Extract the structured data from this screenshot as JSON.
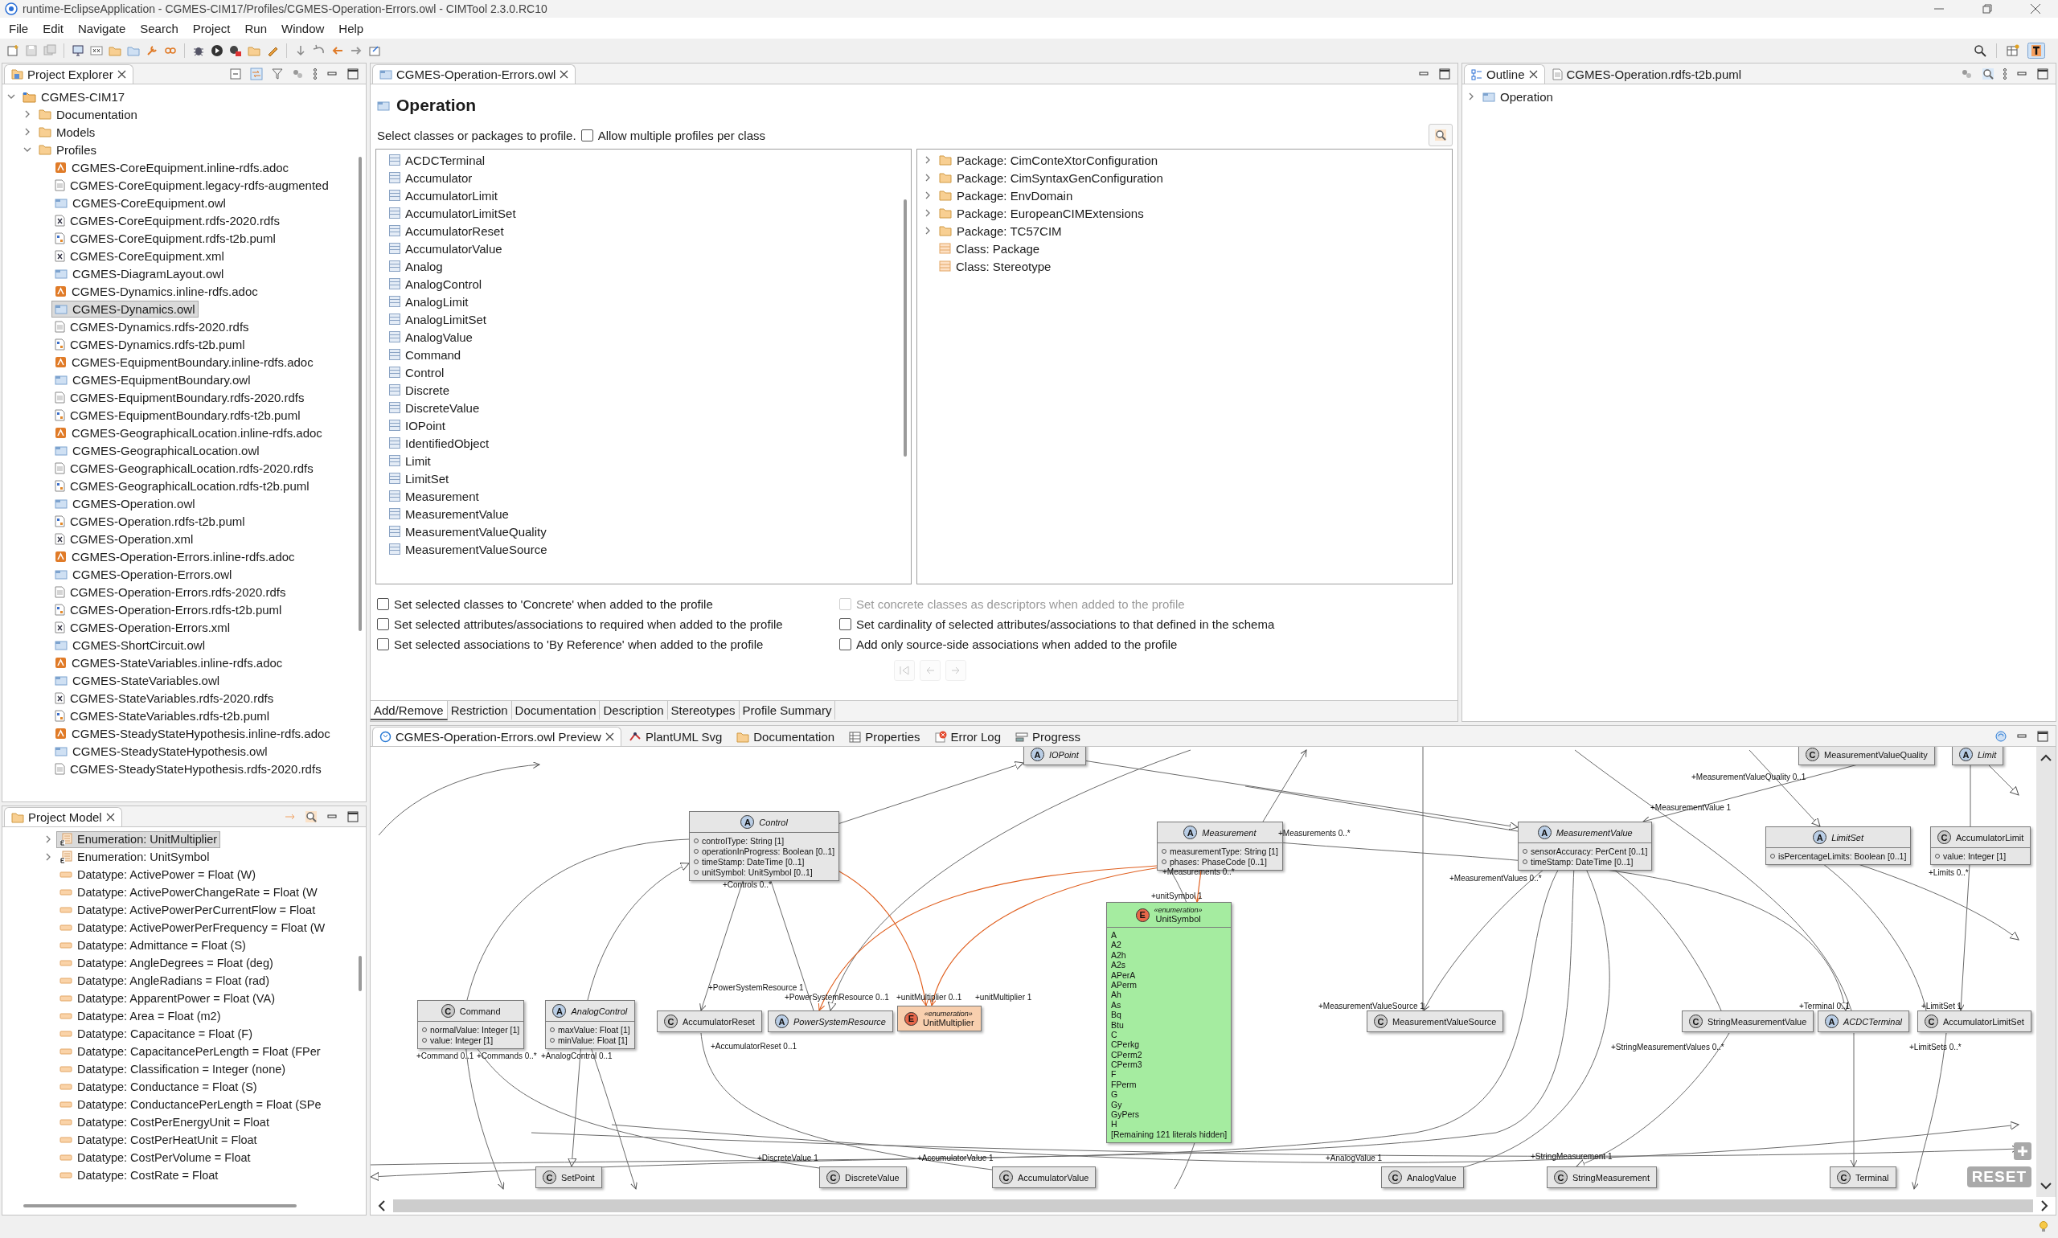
{
  "window": {
    "title": "runtime-EclipseApplication - CGMES-CIM17/Profiles/CGMES-Operation-Errors.owl - CIMTool 2.3.0.RC10"
  },
  "menu": [
    "File",
    "Edit",
    "Navigate",
    "Search",
    "Project",
    "Run",
    "Window",
    "Help"
  ],
  "project_explorer": {
    "title": "Project Explorer",
    "tree": [
      {
        "label": "CGMES-CIM17",
        "kind": "project",
        "expanded": true,
        "selected": false,
        "children": [
          {
            "label": "Documentation",
            "kind": "folder",
            "expanded": false,
            "selected": false
          },
          {
            "label": "Models",
            "kind": "folder",
            "expanded": false,
            "selected": false
          },
          {
            "label": "Profiles",
            "kind": "folder",
            "expanded": true,
            "selected": false,
            "children": [
              {
                "label": "CGMES-CoreEquipment.inline-rdfs.adoc",
                "kind": "adoc",
                "selected": false
              },
              {
                "label": "CGMES-CoreEquipment.legacy-rdfs-augmented",
                "kind": "text",
                "selected": false
              },
              {
                "label": "CGMES-CoreEquipment.owl",
                "kind": "owl",
                "selected": false
              },
              {
                "label": "CGMES-CoreEquipment.rdfs-2020.rdfs",
                "kind": "xml",
                "selected": false
              },
              {
                "label": "CGMES-CoreEquipment.rdfs-t2b.puml",
                "kind": "puml",
                "selected": false
              },
              {
                "label": "CGMES-CoreEquipment.xml",
                "kind": "xml",
                "selected": false
              },
              {
                "label": "CGMES-DiagramLayout.owl",
                "kind": "owl",
                "selected": false
              },
              {
                "label": "CGMES-Dynamics.inline-rdfs.adoc",
                "kind": "adoc",
                "selected": false
              },
              {
                "label": "CGMES-Dynamics.owl",
                "kind": "owl",
                "selected": true
              },
              {
                "label": "CGMES-Dynamics.rdfs-2020.rdfs",
                "kind": "text",
                "selected": false
              },
              {
                "label": "CGMES-Dynamics.rdfs-t2b.puml",
                "kind": "puml",
                "selected": false
              },
              {
                "label": "CGMES-EquipmentBoundary.inline-rdfs.adoc",
                "kind": "adoc",
                "selected": false
              },
              {
                "label": "CGMES-EquipmentBoundary.owl",
                "kind": "owl",
                "selected": false
              },
              {
                "label": "CGMES-EquipmentBoundary.rdfs-2020.rdfs",
                "kind": "text",
                "selected": false
              },
              {
                "label": "CGMES-EquipmentBoundary.rdfs-t2b.puml",
                "kind": "puml",
                "selected": false
              },
              {
                "label": "CGMES-GeographicalLocation.inline-rdfs.adoc",
                "kind": "adoc",
                "selected": false
              },
              {
                "label": "CGMES-GeographicalLocation.owl",
                "kind": "owl",
                "selected": false
              },
              {
                "label": "CGMES-GeographicalLocation.rdfs-2020.rdfs",
                "kind": "text",
                "selected": false
              },
              {
                "label": "CGMES-GeographicalLocation.rdfs-t2b.puml",
                "kind": "puml",
                "selected": false
              },
              {
                "label": "CGMES-Operation.owl",
                "kind": "owl",
                "selected": false
              },
              {
                "label": "CGMES-Operation.rdfs-t2b.puml",
                "kind": "puml",
                "selected": false
              },
              {
                "label": "CGMES-Operation.xml",
                "kind": "xml",
                "selected": false
              },
              {
                "label": "CGMES-Operation-Errors.inline-rdfs.adoc",
                "kind": "adoc",
                "selected": false
              },
              {
                "label": "CGMES-Operation-Errors.owl",
                "kind": "owl",
                "selected": false
              },
              {
                "label": "CGMES-Operation-Errors.rdfs-2020.rdfs",
                "kind": "text",
                "selected": false
              },
              {
                "label": "CGMES-Operation-Errors.rdfs-t2b.puml",
                "kind": "puml",
                "selected": false
              },
              {
                "label": "CGMES-Operation-Errors.xml",
                "kind": "xml",
                "selected": false
              },
              {
                "label": "CGMES-ShortCircuit.owl",
                "kind": "owl",
                "selected": false
              },
              {
                "label": "CGMES-StateVariables.inline-rdfs.adoc",
                "kind": "adoc",
                "selected": false
              },
              {
                "label": "CGMES-StateVariables.owl",
                "kind": "owl",
                "selected": false
              },
              {
                "label": "CGMES-StateVariables.rdfs-2020.rdfs",
                "kind": "xml",
                "selected": false
              },
              {
                "label": "CGMES-StateVariables.rdfs-t2b.puml",
                "kind": "puml",
                "selected": false
              },
              {
                "label": "CGMES-SteadyStateHypothesis.inline-rdfs.adoc",
                "kind": "adoc",
                "selected": false
              },
              {
                "label": "CGMES-SteadyStateHypothesis.owl",
                "kind": "owl",
                "selected": false
              },
              {
                "label": "CGMES-SteadyStateHypothesis.rdfs-2020.rdfs",
                "kind": "text",
                "selected": false
              }
            ]
          }
        ]
      }
    ]
  },
  "project_model": {
    "title": "Project Model",
    "items": [
      {
        "label": "Enumeration: UnitMultiplier",
        "kind": "enumeration",
        "expanded": false,
        "selected": true
      },
      {
        "label": "Enumeration: UnitSymbol",
        "kind": "enumeration",
        "expanded": false,
        "selected": false
      },
      {
        "label": "Datatype: ActivePower = Float (W)",
        "kind": "datatype",
        "selected": false
      },
      {
        "label": "Datatype: ActivePowerChangeRate = Float (W",
        "kind": "datatype",
        "selected": false
      },
      {
        "label": "Datatype: ActivePowerPerCurrentFlow = Float",
        "kind": "datatype",
        "selected": false
      },
      {
        "label": "Datatype: ActivePowerPerFrequency = Float (W",
        "kind": "datatype",
        "selected": false
      },
      {
        "label": "Datatype: Admittance = Float (S)",
        "kind": "datatype",
        "selected": false
      },
      {
        "label": "Datatype: AngleDegrees = Float (deg)",
        "kind": "datatype",
        "selected": false
      },
      {
        "label": "Datatype: AngleRadians = Float (rad)",
        "kind": "datatype",
        "selected": false
      },
      {
        "label": "Datatype: ApparentPower = Float (VA)",
        "kind": "datatype",
        "selected": false
      },
      {
        "label": "Datatype: Area = Float (m2)",
        "kind": "datatype",
        "selected": false
      },
      {
        "label": "Datatype: Capacitance = Float (F)",
        "kind": "datatype",
        "selected": false
      },
      {
        "label": "Datatype: CapacitancePerLength = Float (FPer",
        "kind": "datatype",
        "selected": false
      },
      {
        "label": "Datatype: Classification = Integer (none)",
        "kind": "datatype",
        "selected": false
      },
      {
        "label": "Datatype: Conductance = Float (S)",
        "kind": "datatype",
        "selected": false
      },
      {
        "label": "Datatype: ConductancePerLength = Float (SPe",
        "kind": "datatype",
        "selected": false
      },
      {
        "label": "Datatype: CostPerEnergyUnit = Float",
        "kind": "datatype",
        "selected": false
      },
      {
        "label": "Datatype: CostPerHeatUnit = Float",
        "kind": "datatype",
        "selected": false
      },
      {
        "label": "Datatype: CostPerVolume = Float",
        "kind": "datatype",
        "selected": false
      },
      {
        "label": "Datatype: CostRate = Float",
        "kind": "datatype",
        "selected": false
      }
    ]
  },
  "editor": {
    "tab": "CGMES-Operation-Errors.owl",
    "title": "Operation",
    "prompt": "Select classes or packages to profile.",
    "allow_multiple": {
      "label": "Allow multiple profiles per class",
      "checked": false
    },
    "classes": [
      "ACDCTerminal",
      "Accumulator",
      "AccumulatorLimit",
      "AccumulatorLimitSet",
      "AccumulatorReset",
      "AccumulatorValue",
      "Analog",
      "AnalogControl",
      "AnalogLimit",
      "AnalogLimitSet",
      "AnalogValue",
      "Command",
      "Control",
      "Discrete",
      "DiscreteValue",
      "IOPoint",
      "IdentifiedObject",
      "Limit",
      "LimitSet",
      "Measurement",
      "MeasurementValue",
      "MeasurementValueQuality",
      "MeasurementValueSource"
    ],
    "packages": [
      {
        "label": "Package: CimConteXtorConfiguration",
        "kind": "package",
        "expanded": false
      },
      {
        "label": "Package: CimSyntaxGenConfiguration",
        "kind": "package",
        "expanded": false
      },
      {
        "label": "Package: EnvDomain",
        "kind": "package",
        "expanded": false
      },
      {
        "label": "Package: EuropeanCIMExtensions",
        "kind": "package",
        "expanded": false
      },
      {
        "label": "Package: TC57CIM",
        "kind": "package",
        "expanded": false
      },
      {
        "label": "Class: Package",
        "kind": "class"
      },
      {
        "label": "Class: Stereotype",
        "kind": "class"
      }
    ],
    "options_left": [
      {
        "label": "Set selected classes to 'Concrete' when added to the profile",
        "checked": false,
        "disabled": false
      },
      {
        "label": "Set selected attributes/associations to required when added to the profile",
        "checked": false,
        "disabled": false
      },
      {
        "label": "Set selected associations to 'By Reference' when added to the profile",
        "checked": false,
        "disabled": false
      }
    ],
    "options_right": [
      {
        "label": "Set concrete classes as descriptors when added to the profile",
        "checked": false,
        "disabled": true
      },
      {
        "label": "Set cardinality of selected attributes/associations to that defined in the schema",
        "checked": false,
        "disabled": false
      },
      {
        "label": "Add only source-side associations when added to the profile",
        "checked": false,
        "disabled": false
      }
    ],
    "navigation": {
      "disabled": true
    },
    "tabs": [
      {
        "label": "Add/Remove",
        "selected": true
      },
      {
        "label": "Restriction",
        "selected": false
      },
      {
        "label": "Documentation",
        "selected": false
      },
      {
        "label": "Description",
        "selected": false
      },
      {
        "label": "Stereotypes",
        "selected": false
      },
      {
        "label": "Profile Summary",
        "selected": false
      }
    ]
  },
  "outline": {
    "tabs": [
      {
        "label": "Outline",
        "selected": true
      },
      {
        "label": "CGMES-Operation.rdfs-t2b.puml",
        "selected": false
      }
    ],
    "tree": [
      {
        "label": "Operation",
        "expanded": false
      }
    ]
  },
  "preview": {
    "tabs": [
      {
        "label": "CGMES-Operation-Errors.owl Preview",
        "selected": true
      },
      {
        "label": "PlantUML Svg",
        "selected": false
      },
      {
        "label": "Documentation",
        "selected": false
      },
      {
        "label": "Properties",
        "selected": false
      },
      {
        "label": "Error Log",
        "selected": false
      },
      {
        "label": "Progress",
        "selected": false
      }
    ],
    "diagram": {
      "nodes": [
        {
          "name": "IOPoint",
          "badge": "A",
          "kind": "abstract",
          "color": "#e6e6e6"
        },
        {
          "name": "MeasurementValueQuality",
          "badge": "C",
          "kind": "class",
          "color": "#e6e6e6"
        },
        {
          "name": "Limit",
          "badge": "A",
          "kind": "abstract",
          "color": "#e6e6e6"
        },
        {
          "name": "Control",
          "badge": "A",
          "kind": "abstract",
          "color": "#e6e6e6",
          "attributes": [
            "controlType: String [1]",
            "operationInProgress: Boolean [0..1]",
            "timeStamp: DateTime [0..1]",
            "unitSymbol: UnitSymbol [0..1]"
          ]
        },
        {
          "name": "Measurement",
          "badge": "A",
          "kind": "abstract",
          "color": "#e6e6e6",
          "attributes": [
            "measurementType: String [1]",
            "phases: PhaseCode [0..1]"
          ]
        },
        {
          "name": "MeasurementValue",
          "badge": "A",
          "kind": "abstract",
          "color": "#e6e6e6",
          "attributes": [
            "sensorAccuracy: PerCent [0..1]",
            "timeStamp: DateTime [0..1]"
          ]
        },
        {
          "name": "LimitSet",
          "badge": "A",
          "kind": "abstract",
          "color": "#e6e6e6",
          "attributes": [
            "isPercentageLimits: Boolean [0..1]"
          ]
        },
        {
          "name": "AccumulatorLimit",
          "badge": "C",
          "kind": "class",
          "color": "#e6e6e6",
          "attributes": [
            "value: Integer [1]"
          ]
        },
        {
          "name": "UnitSymbol",
          "badge": "E",
          "kind": "enumeration",
          "color": "#a5eca0",
          "stereotype": "«enumeration»",
          "literals": [
            "A",
            "A2",
            "A2h",
            "A2s",
            "APerA",
            "APerm",
            "Ah",
            "As",
            "Bq",
            "Btu",
            "C",
            "CPerkg",
            "CPerm2",
            "CPerm3",
            "F",
            "FPerm",
            "G",
            "Gy",
            "GyPers",
            "H"
          ],
          "note": "[Remaining 121 literals hidden]"
        },
        {
          "name": "Command",
          "badge": "C",
          "kind": "class",
          "color": "#e6e6e6",
          "attributes": [
            "normalValue: Integer [1]",
            "value: Integer [1]"
          ]
        },
        {
          "name": "AnalogControl",
          "badge": "A",
          "kind": "abstract",
          "color": "#e6e6e6",
          "attributes": [
            "maxValue: Float [1]",
            "minValue: Float [1]"
          ]
        },
        {
          "name": "AccumulatorReset",
          "badge": "C",
          "kind": "class",
          "color": "#e6e6e6"
        },
        {
          "name": "PowerSystemResource",
          "badge": "A",
          "kind": "abstract",
          "color": "#e6e6e6"
        },
        {
          "name": "UnitMultiplier",
          "badge": "E",
          "kind": "enumeration",
          "color": "#f8cfae",
          "stereotype": "«enumeration»"
        },
        {
          "name": "MeasurementValueSource",
          "badge": "C",
          "kind": "class",
          "color": "#e6e6e6"
        },
        {
          "name": "StringMeasurementValue",
          "badge": "C",
          "kind": "class",
          "color": "#e6e6e6"
        },
        {
          "name": "ACDCTerminal",
          "badge": "A",
          "kind": "abstract",
          "color": "#e6e6e6"
        },
        {
          "name": "AccumulatorLimitSet",
          "badge": "C",
          "kind": "class",
          "color": "#e6e6e6"
        },
        {
          "name": "SetPoint",
          "badge": "C",
          "kind": "class",
          "color": "#e6e6e6"
        },
        {
          "name": "DiscreteValue",
          "badge": "C",
          "kind": "class",
          "color": "#e6e6e6"
        },
        {
          "name": "AccumulatorValue",
          "badge": "C",
          "kind": "class",
          "color": "#e6e6e6"
        },
        {
          "name": "AnalogValue",
          "badge": "C",
          "kind": "class",
          "color": "#e6e6e6"
        },
        {
          "name": "StringMeasurement",
          "badge": "C",
          "kind": "class",
          "color": "#e6e6e6"
        },
        {
          "name": "Terminal",
          "badge": "C",
          "kind": "class",
          "color": "#e6e6e6"
        }
      ],
      "edge_labels": [
        "+MeasurementValueQuality 0..1",
        "+MeasurementValue 1",
        "+Controls 0..*",
        "+Measurements 0..*",
        "+Measurements 0..*",
        "+MeasurementValues 0..*",
        "+Limits 0..*",
        "+unitSymbol 1",
        "+PowerSystemResource 1",
        "+PowerSystemResource 0..1",
        "+unitMultiplier 0..1",
        "+unitMultiplier 1",
        "+AccumulatorReset 0..1",
        "+Command 0..1",
        "+Commands 0..*",
        "+AnalogControl 0..1",
        "+MeasurementValueSource 1",
        "+Terminal 0..1",
        "+LimitSet 1",
        "+StringMeasurementValues 0..*",
        "+LimitSets 0..*",
        "+DiscreteValue 1",
        "+AccumulatorValue 1",
        "+AnalogValue 1",
        "+StringMeasurement 1"
      ],
      "reset_button": "RESET"
    }
  }
}
